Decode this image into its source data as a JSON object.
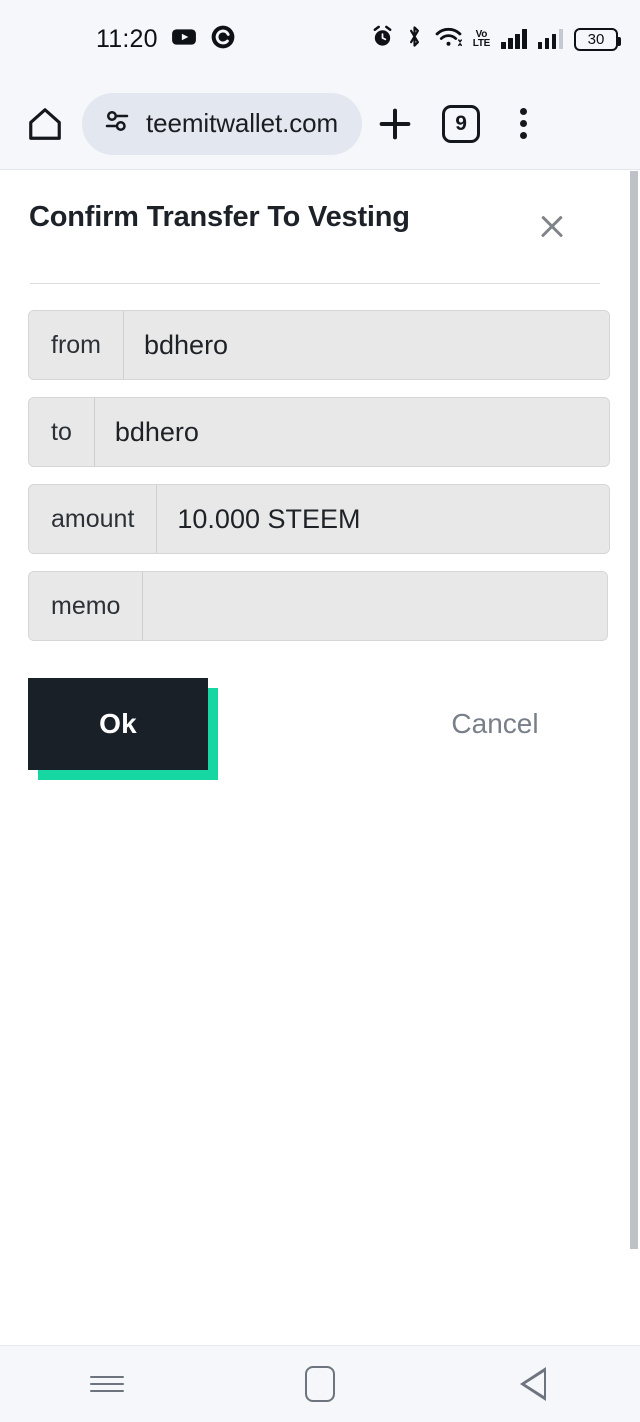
{
  "status_bar": {
    "time": "11:20",
    "battery_percent": "30",
    "volte_top": "Vo",
    "volte_bottom": "LTE",
    "icons": [
      "youtube-icon",
      "chrome-c-icon",
      "alarm-icon",
      "bluetooth-icon",
      "wifi-icon",
      "volte-icon",
      "signal-bars-sim1",
      "signal-bars-sim2",
      "battery-icon"
    ]
  },
  "browser": {
    "url": "teemitwallet.com",
    "tab_count": "9",
    "home_icon": "home-icon",
    "page_info_icon": "tune-icon",
    "new_tab_icon": "plus-icon",
    "menu_icon": "three-dot-menu-icon"
  },
  "dialog": {
    "title": "Confirm Transfer To Vesting",
    "close_icon": "close-icon",
    "fields": [
      {
        "label": "from",
        "value": "bdhero"
      },
      {
        "label": "to",
        "value": "bdhero"
      },
      {
        "label": "amount",
        "value": "10.000 STEEM"
      },
      {
        "label": "memo",
        "value": ""
      }
    ],
    "ok_label": "Ok",
    "cancel_label": "Cancel"
  },
  "colors": {
    "accent_teal": "#16D6A2",
    "button_dark": "#1A2028",
    "cancel_gray": "#787F89",
    "chrome_bar": "#F5F7FB",
    "url_pill": "#E2E7F0",
    "field_bg": "#E8E8E8"
  },
  "nav_bar": {
    "recents_label": "recents-icon",
    "home_label": "home-square-icon",
    "back_label": "back-triangle-icon"
  }
}
